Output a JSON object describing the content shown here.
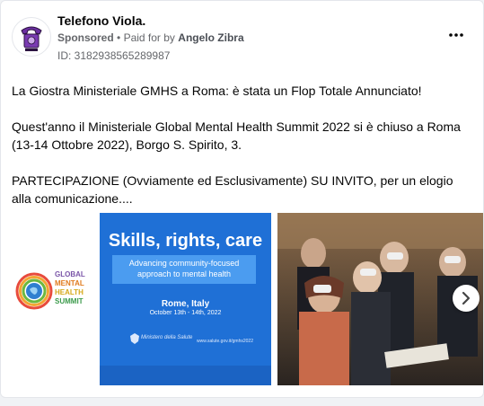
{
  "post": {
    "page_name": "Telefono Viola.",
    "sponsored_label": "Sponsored",
    "separator": "•",
    "paid_for_label": "Paid for by",
    "advertiser": "Angelo Zibra",
    "ad_id": "ID: 3182938565289987",
    "more_icon": "more-horizontal-icon",
    "body_paragraphs": [
      "La Giostra Ministeriale GMHS a Roma: è stata un Flop Totale Annunciato!",
      "Quest'anno il Ministeriale Global Mental Health Summit 2022 si è chiuso a Roma (13-14 Ottobre 2022), Borgo S. Spirito, 3.",
      "PARTECIPAZIONE (Ovviamente ed Esclusivamente) SU INVITO, per un elogio alla comunicazione...."
    ]
  },
  "carousel": {
    "slide1": {
      "logo_lines": [
        "GLOBAL",
        "MENTAL",
        "HEALTH",
        "SUMMIT"
      ],
      "headline": "Skills, rights, care",
      "subheading": "Advancing community-focused approach to mental health",
      "location": "Rome, Italy",
      "dates": "October 13th - 14th, 2022",
      "ministry": "Ministero della Salute",
      "website": "www.salute.gov.it/gmhs2022"
    },
    "next_icon": "chevron-right-icon"
  },
  "colors": {
    "banner_blue": "#1f70d6",
    "text_primary": "#050505",
    "text_secondary": "#65676b"
  }
}
